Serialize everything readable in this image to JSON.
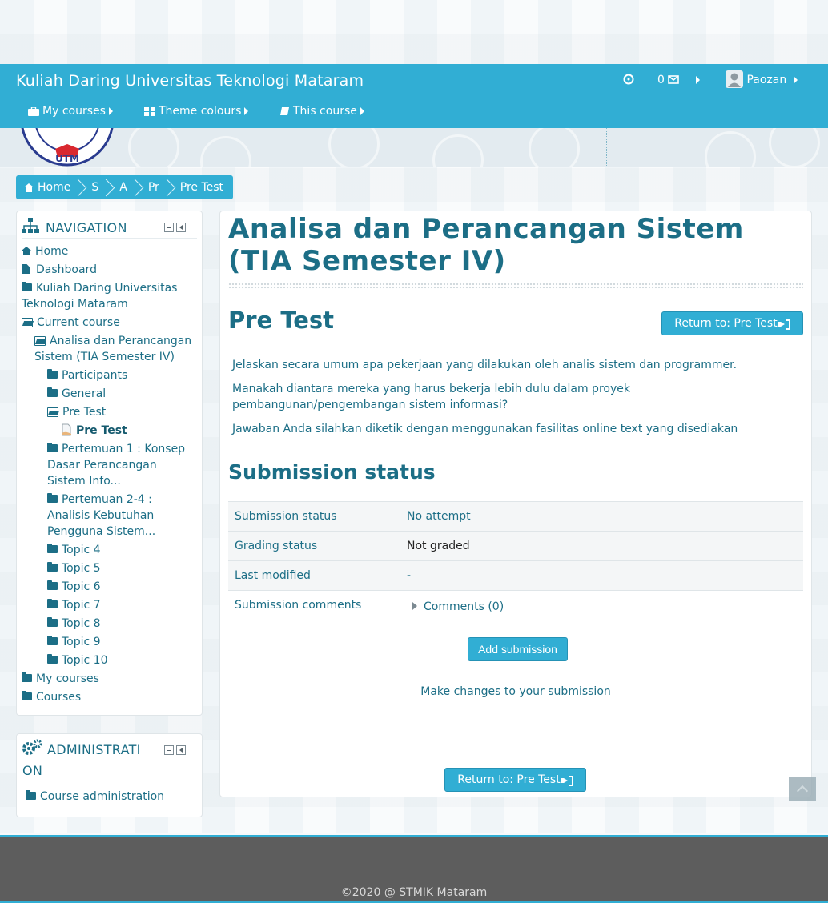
{
  "navbar": {
    "brand": "Kuliah Daring Universitas Teknologi Mataram",
    "message_count": "0",
    "user_name": "Paozan",
    "menu": [
      {
        "label": "My courses"
      },
      {
        "label": "Theme colours"
      },
      {
        "label": "This course"
      }
    ]
  },
  "breadcrumb": [
    "Home",
    "S",
    "A",
    "Pr",
    "Pre Test"
  ],
  "navigation_block": {
    "title": "NAVIGATION",
    "items": [
      {
        "label": "Home"
      },
      {
        "label": "Dashboard"
      },
      {
        "label": "Kuliah Daring Universitas Teknologi Mataram"
      },
      {
        "label": "Current course"
      },
      {
        "label": "Analisa dan Perancangan Sistem (TIA Semester IV)"
      },
      {
        "label": "Participants"
      },
      {
        "label": "General"
      },
      {
        "label": "Pre Test"
      },
      {
        "label": "Pre Test"
      },
      {
        "label": "Pertemuan 1 : Konsep Dasar Perancangan Sistem Info..."
      },
      {
        "label": "Pertemuan 2-4 : Analisis Kebutuhan Pengguna Sistem..."
      },
      {
        "label": "Topic 4"
      },
      {
        "label": "Topic 5"
      },
      {
        "label": "Topic 6"
      },
      {
        "label": "Topic 7"
      },
      {
        "label": "Topic 8"
      },
      {
        "label": "Topic 9"
      },
      {
        "label": "Topic 10"
      },
      {
        "label": "My courses"
      },
      {
        "label": "Courses"
      }
    ]
  },
  "administration_block": {
    "title_line1": "ADMINISTRATI",
    "title_line2": "ON",
    "items": [
      {
        "label": "Course administration"
      }
    ]
  },
  "main": {
    "course_title": "Analisa dan Perancangan Sistem (TIA Semester IV)",
    "assignment_title": "Pre Test",
    "return_button": "Return to: Pre Test",
    "intro": [
      "Jelaskan secara umum apa pekerjaan yang dilakukan oleh analis sistem dan programmer.",
      "Manakah diantara mereka yang harus bekerja lebih dulu dalam proyek pembangunan/pengembangan sistem informasi?",
      "Jawaban Anda silahkan diketik dengan menggunakan fasilitas online text yang disediakan"
    ],
    "submission_heading": "Submission status",
    "status_rows": [
      {
        "label": "Submission status",
        "value": "No attempt"
      },
      {
        "label": "Grading status",
        "value": "Not graded"
      },
      {
        "label": "Last modified",
        "value": "-"
      },
      {
        "label": "Submission comments",
        "value": "Comments (0)"
      }
    ],
    "add_submission_button": "Add submission",
    "make_changes_text": "Make changes to your submission",
    "bottom_return_button": "Return to: Pre Test"
  },
  "footer": {
    "copyright": "©2020 @ STMIK Mataram"
  }
}
